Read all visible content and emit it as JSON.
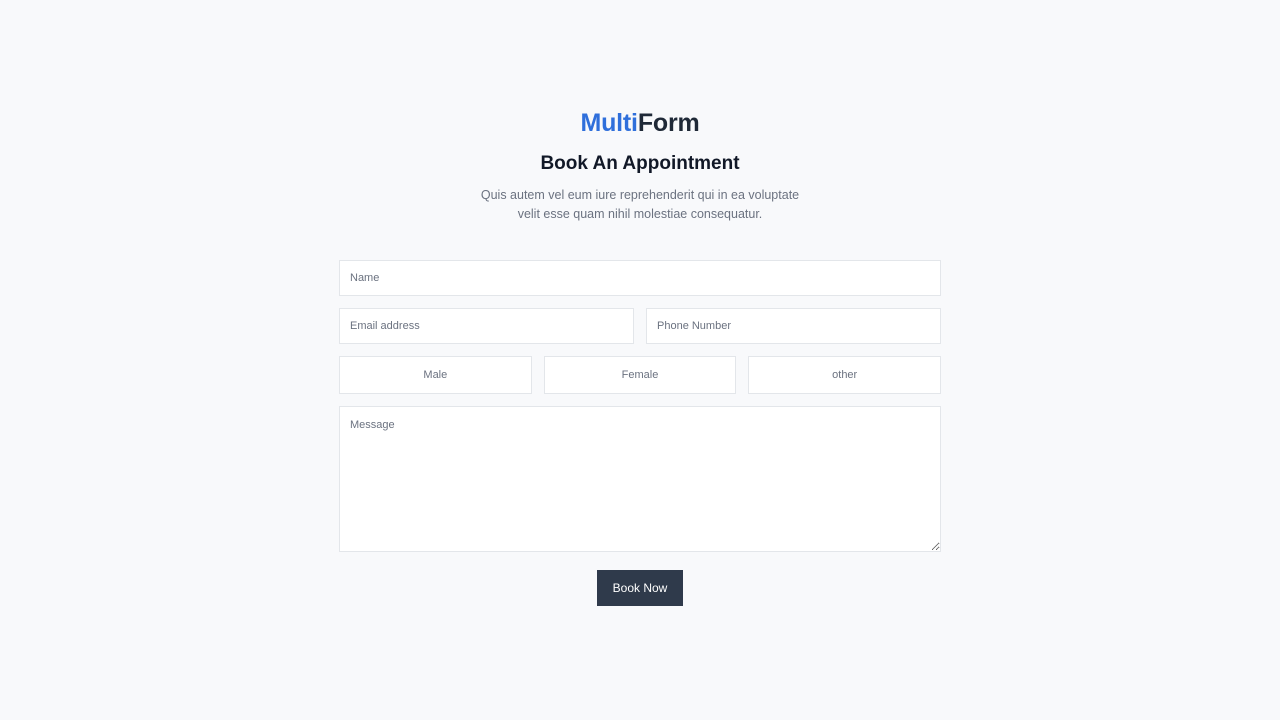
{
  "brand": {
    "part1": "Multi",
    "part2": "Form",
    "accent_color": "#2f6fdb"
  },
  "header": {
    "title": "Book An Appointment",
    "subtitle": "Quis autem vel eum iure reprehenderit qui in ea voluptate velit esse quam nihil molestiae consequatur."
  },
  "form": {
    "name_placeholder": "Name",
    "email_placeholder": "Email address",
    "phone_placeholder": "Phone Number",
    "gender_options": [
      "Male",
      "Female",
      "other"
    ],
    "message_placeholder": "Message",
    "submit_label": "Book Now",
    "submit_color": "#2f3a4b"
  }
}
